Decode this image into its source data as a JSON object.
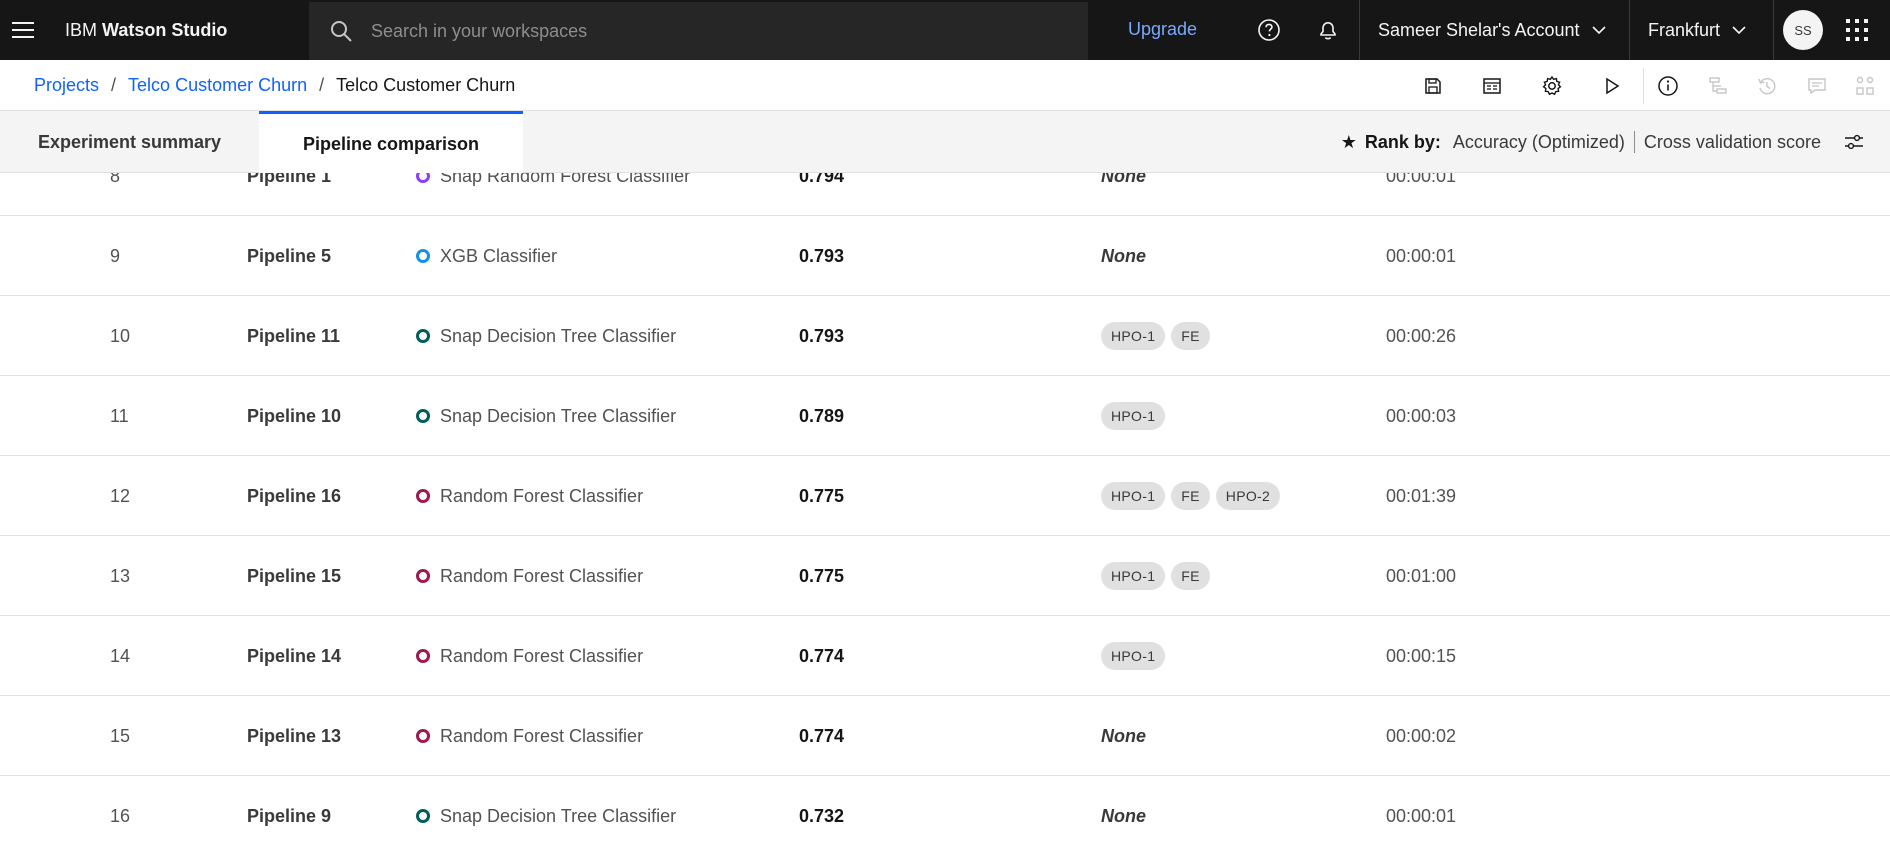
{
  "header": {
    "brand_prefix": "IBM ",
    "brand_name": "Watson Studio",
    "search_placeholder": "Search in your workspaces",
    "upgrade_label": "Upgrade",
    "account_label": "Sameer Shelar's Account",
    "region_label": "Frankfurt",
    "avatar_initials": "SS"
  },
  "breadcrumb": {
    "items": [
      "Projects",
      "Telco Customer Churn"
    ],
    "separator": "/",
    "current": "Telco Customer Churn"
  },
  "tabs": [
    {
      "label": "Experiment summary",
      "selected": false
    },
    {
      "label": "Pipeline comparison",
      "selected": true
    }
  ],
  "rank_by": {
    "star": "★",
    "label": "Rank by:",
    "metric": "Accuracy (Optimized)",
    "score_type": "Cross validation score"
  },
  "colors": {
    "purple": "#8a3ffc",
    "cyan": "#1192e8",
    "teal": "#005d5d",
    "magenta": "#9f1853",
    "link": "#0f62fe"
  },
  "rows": [
    {
      "rank": "8",
      "name": "Pipeline 1",
      "algorithm": "Snap Random Forest Classifier",
      "color": "#8a3ffc",
      "accuracy": "0.794",
      "enhancements": [],
      "none_label": "None",
      "build_time": "00:00:01"
    },
    {
      "rank": "9",
      "name": "Pipeline 5",
      "algorithm": "XGB Classifier",
      "color": "#1192e8",
      "accuracy": "0.793",
      "enhancements": [],
      "none_label": "None",
      "build_time": "00:00:01"
    },
    {
      "rank": "10",
      "name": "Pipeline 11",
      "algorithm": "Snap Decision Tree Classifier",
      "color": "#005d5d",
      "accuracy": "0.793",
      "enhancements": [
        "HPO-1",
        "FE"
      ],
      "none_label": "",
      "build_time": "00:00:26"
    },
    {
      "rank": "11",
      "name": "Pipeline 10",
      "algorithm": "Snap Decision Tree Classifier",
      "color": "#005d5d",
      "accuracy": "0.789",
      "enhancements": [
        "HPO-1"
      ],
      "none_label": "",
      "build_time": "00:00:03"
    },
    {
      "rank": "12",
      "name": "Pipeline 16",
      "algorithm": "Random Forest Classifier",
      "color": "#9f1853",
      "accuracy": "0.775",
      "enhancements": [
        "HPO-1",
        "FE",
        "HPO-2"
      ],
      "none_label": "",
      "build_time": "00:01:39"
    },
    {
      "rank": "13",
      "name": "Pipeline 15",
      "algorithm": "Random Forest Classifier",
      "color": "#9f1853",
      "accuracy": "0.775",
      "enhancements": [
        "HPO-1",
        "FE"
      ],
      "none_label": "",
      "build_time": "00:01:00"
    },
    {
      "rank": "14",
      "name": "Pipeline 14",
      "algorithm": "Random Forest Classifier",
      "color": "#9f1853",
      "accuracy": "0.774",
      "enhancements": [
        "HPO-1"
      ],
      "none_label": "",
      "build_time": "00:00:15"
    },
    {
      "rank": "15",
      "name": "Pipeline 13",
      "algorithm": "Random Forest Classifier",
      "color": "#9f1853",
      "accuracy": "0.774",
      "enhancements": [],
      "none_label": "None",
      "build_time": "00:00:02"
    },
    {
      "rank": "16",
      "name": "Pipeline 9",
      "algorithm": "Snap Decision Tree Classifier",
      "color": "#005d5d",
      "accuracy": "0.732",
      "enhancements": [],
      "none_label": "None",
      "build_time": "00:00:01"
    }
  ],
  "toolbar_icons": [
    "save-icon",
    "notebook-icon",
    "settings-icon",
    "run-icon",
    "info-icon",
    "lineage-icon",
    "history-icon",
    "comment-icon",
    "hierarchy-icon"
  ]
}
